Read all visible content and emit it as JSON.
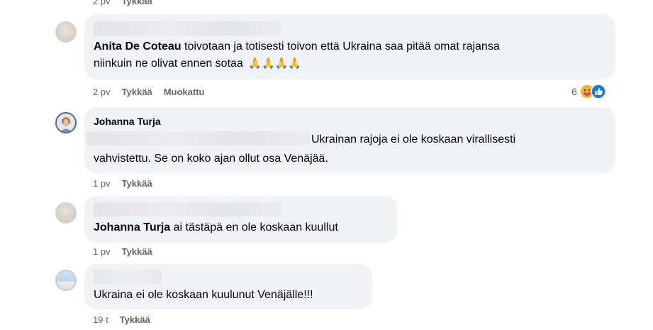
{
  "comments": [
    {
      "id": "top_partial",
      "meta": {
        "time": "2 pv",
        "like": "Tykkää"
      }
    },
    {
      "id": "anita",
      "author": "Anita De Coteau",
      "text_line1": "toivotaan ja totisesti toivon että Ukraina saa pitää omat rajansa",
      "text_line2": "niinkuin ne olivat ennen sotaa",
      "emoji": "🙏🙏🙏🙏",
      "meta": {
        "time": "2 pv",
        "like": "Tykkää",
        "edited": "Muokattu"
      },
      "reactions": {
        "count": "6",
        "icons": [
          "care-reaction-icon",
          "like-reaction-icon"
        ]
      }
    },
    {
      "id": "johanna",
      "author": "Johanna Turja",
      "text_line1": "Ukrainan rajoja ei ole koskaan virallisesti",
      "text_line2": "vahvistettu. Se on koko ajan ollut osa Venäjää.",
      "meta": {
        "time": "1 pv",
        "like": "Tykkää"
      }
    },
    {
      "id": "reply1",
      "mention": "Johanna Turja",
      "text": "ai tästäpä en ole koskaan kuullut",
      "meta": {
        "time": "1 pv",
        "like": "Tykkää"
      }
    },
    {
      "id": "reply2",
      "text": "Ukraina ei ole koskaan kuulunut Venäjälle!!!",
      "meta": {
        "time": "19 t",
        "like": "Tykkää"
      }
    }
  ],
  "colors": {
    "bubble": "#f0f2f5",
    "meta_text": "#65676b",
    "like_blue": "#1877f2",
    "care_yellow": "#f7b928"
  }
}
